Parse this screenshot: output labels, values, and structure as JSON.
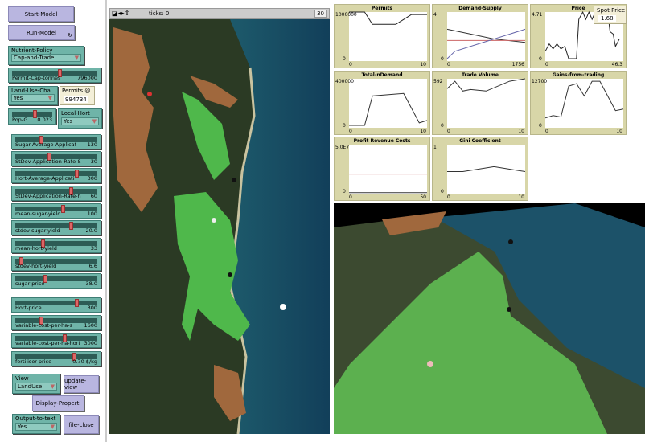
{
  "buttons": {
    "start": "Start-Model",
    "run": "Run-Model",
    "update_view": "update-view",
    "display": "Display-Properti",
    "file_close": "file-close"
  },
  "choosers": {
    "nutrient_policy": {
      "label": "Nutrient-Policy",
      "value": "Cap-and-Trade"
    },
    "land_use": {
      "label": "Land-Use-Cha",
      "value": "Yes"
    },
    "local_hort": {
      "label": "Local-Hort",
      "value": "Yes"
    },
    "view": {
      "label": "View",
      "value": "LandUse"
    },
    "output": {
      "label": "Output-to-text",
      "value": "Yes"
    }
  },
  "monitors": {
    "permits": {
      "label": "Permits @",
      "value": "994734"
    },
    "spot_price": {
      "label": "Spot Price",
      "value": "1.68"
    }
  },
  "sliders": [
    {
      "name": "Permit-Cap-tonnes",
      "value": "796000",
      "fraction": 0.55
    },
    {
      "name": "Pop-G",
      "value": "0.023",
      "fraction": 0.55
    },
    {
      "name": "Sugar-Average-Applicat",
      "value": "130",
      "fraction": 0.3
    },
    {
      "name": "StDev-Application-Rate-S",
      "value": "30",
      "fraction": 0.4
    },
    {
      "name": "Hort-Average-Applicati",
      "value": "300",
      "fraction": 0.75
    },
    {
      "name": "StDev-Application-Rate-h",
      "value": "60",
      "fraction": 0.68
    },
    {
      "name": "mean-sugar-yield",
      "value": "100",
      "fraction": 0.58
    },
    {
      "name": "stdev-sugar-yield",
      "value": "20.0",
      "fraction": 0.68
    },
    {
      "name": "mean-hort-yield",
      "value": "33",
      "fraction": 0.32
    },
    {
      "name": "stdev-hort-yield",
      "value": "6.6",
      "fraction": 0.05
    },
    {
      "name": "sugar-price",
      "value": "38.0",
      "fraction": 0.35
    },
    {
      "name": "Hort-price",
      "value": "300",
      "fraction": 0.75
    },
    {
      "name": "variable-cost-per-ha-s",
      "value": "1600",
      "fraction": 0.3
    },
    {
      "name": "variable-cost-per-ha-hort",
      "value": "3000",
      "fraction": 0.6
    },
    {
      "name": "fertiliser-price",
      "value": "0.70 $/kg",
      "fraction": 0.72
    }
  ],
  "view": {
    "ticks_label": "ticks: 0",
    "speed": "30"
  },
  "plots": [
    {
      "title": "Permits",
      "ymax": "1000000",
      "ymin": "0",
      "xmin": "0",
      "xmax": "10",
      "series": [
        {
          "color": "#222",
          "pts": [
            [
              0,
              1
            ],
            [
              2,
              1
            ],
            [
              3,
              0.75
            ],
            [
              6,
              0.75
            ],
            [
              8,
              0.95
            ],
            [
              10,
              0.95
            ]
          ]
        }
      ]
    },
    {
      "title": "Demand-Supply",
      "ymax": "4",
      "ymin": "0",
      "xmin": "0",
      "xmax": "1756",
      "series": [
        {
          "color": "#333",
          "pts": [
            [
              0,
              0.65
            ],
            [
              3,
              0.55
            ],
            [
              6,
              0.45
            ],
            [
              10,
              0.38
            ]
          ]
        },
        {
          "color": "#c66",
          "pts": [
            [
              0,
              0.42
            ],
            [
              10,
              0.42
            ]
          ]
        },
        {
          "color": "#66a",
          "pts": [
            [
              0,
              0.05
            ],
            [
              1,
              0.2
            ],
            [
              5,
              0.4
            ],
            [
              10,
              0.65
            ]
          ]
        }
      ]
    },
    {
      "title": "Price",
      "ymax": "4.71",
      "ymin": "0",
      "xmin": "0",
      "xmax": "46.3",
      "series": [
        {
          "color": "#222",
          "pts": [
            [
              0,
              0.2
            ],
            [
              0.5,
              0.35
            ],
            [
              1,
              0.25
            ],
            [
              1.5,
              0.35
            ],
            [
              2,
              0.25
            ],
            [
              2.5,
              0.3
            ],
            [
              3,
              0.05
            ],
            [
              4,
              0.05
            ],
            [
              4.3,
              0.85
            ],
            [
              4.8,
              1
            ],
            [
              5.2,
              0.85
            ],
            [
              5.6,
              1
            ],
            [
              6,
              0.85
            ],
            [
              6.4,
              1
            ],
            [
              6.8,
              0.85
            ],
            [
              7.2,
              1
            ],
            [
              7.6,
              0.85
            ],
            [
              8,
              1
            ],
            [
              8.3,
              0.6
            ],
            [
              8.7,
              0.55
            ],
            [
              9,
              0.3
            ],
            [
              9.5,
              0.45
            ],
            [
              10,
              0.45
            ]
          ]
        }
      ]
    },
    {
      "title": "Total-nDemand",
      "ymax": "400000",
      "ymin": "0",
      "xmin": "0",
      "xmax": "10",
      "series": [
        {
          "color": "#333",
          "pts": [
            [
              0,
              0.05
            ],
            [
              2,
              0.05
            ],
            [
              3,
              0.65
            ],
            [
              7,
              0.7
            ],
            [
              9,
              0.1
            ],
            [
              10,
              0.15
            ]
          ]
        }
      ]
    },
    {
      "title": "Trade Volume",
      "ymax": "592",
      "ymin": "0",
      "xmin": "0",
      "xmax": "10",
      "series": [
        {
          "color": "#333",
          "pts": [
            [
              0,
              0.8
            ],
            [
              1,
              0.95
            ],
            [
              2,
              0.75
            ],
            [
              3,
              0.78
            ],
            [
              5,
              0.75
            ],
            [
              8,
              0.95
            ],
            [
              10,
              1
            ]
          ]
        }
      ]
    },
    {
      "title": "Gains-from-trading",
      "ymax": "12700",
      "ymin": "0",
      "xmin": "0",
      "xmax": "10",
      "series": [
        {
          "color": "#333",
          "pts": [
            [
              0,
              0.2
            ],
            [
              1,
              0.25
            ],
            [
              2,
              0.22
            ],
            [
              3,
              0.85
            ],
            [
              4,
              0.9
            ],
            [
              5,
              0.65
            ],
            [
              6,
              0.95
            ],
            [
              7,
              0.95
            ],
            [
              9,
              0.35
            ],
            [
              10,
              0.38
            ]
          ]
        }
      ]
    },
    {
      "title": "Profit Revenue Costs",
      "ymax": "5.0E7",
      "ymin": "0",
      "xmin": "0",
      "xmax": "50",
      "series": [
        {
          "color": "#c66",
          "pts": [
            [
              0,
              0.4
            ],
            [
              10,
              0.4
            ]
          ]
        },
        {
          "color": "#a55",
          "pts": [
            [
              0,
              0.32
            ],
            [
              10,
              0.32
            ]
          ]
        },
        {
          "color": "#333",
          "pts": [
            [
              0,
              0.02
            ],
            [
              10,
              0.02
            ]
          ]
        }
      ]
    },
    {
      "title": "Gini Coefficient",
      "ymax": "1",
      "ymin": "0",
      "xmin": "0",
      "xmax": "10",
      "series": [
        {
          "color": "#333",
          "pts": [
            [
              0,
              0.45
            ],
            [
              2,
              0.45
            ],
            [
              4,
              0.5
            ],
            [
              6,
              0.55
            ],
            [
              8,
              0.5
            ],
            [
              10,
              0.45
            ]
          ]
        }
      ]
    }
  ]
}
